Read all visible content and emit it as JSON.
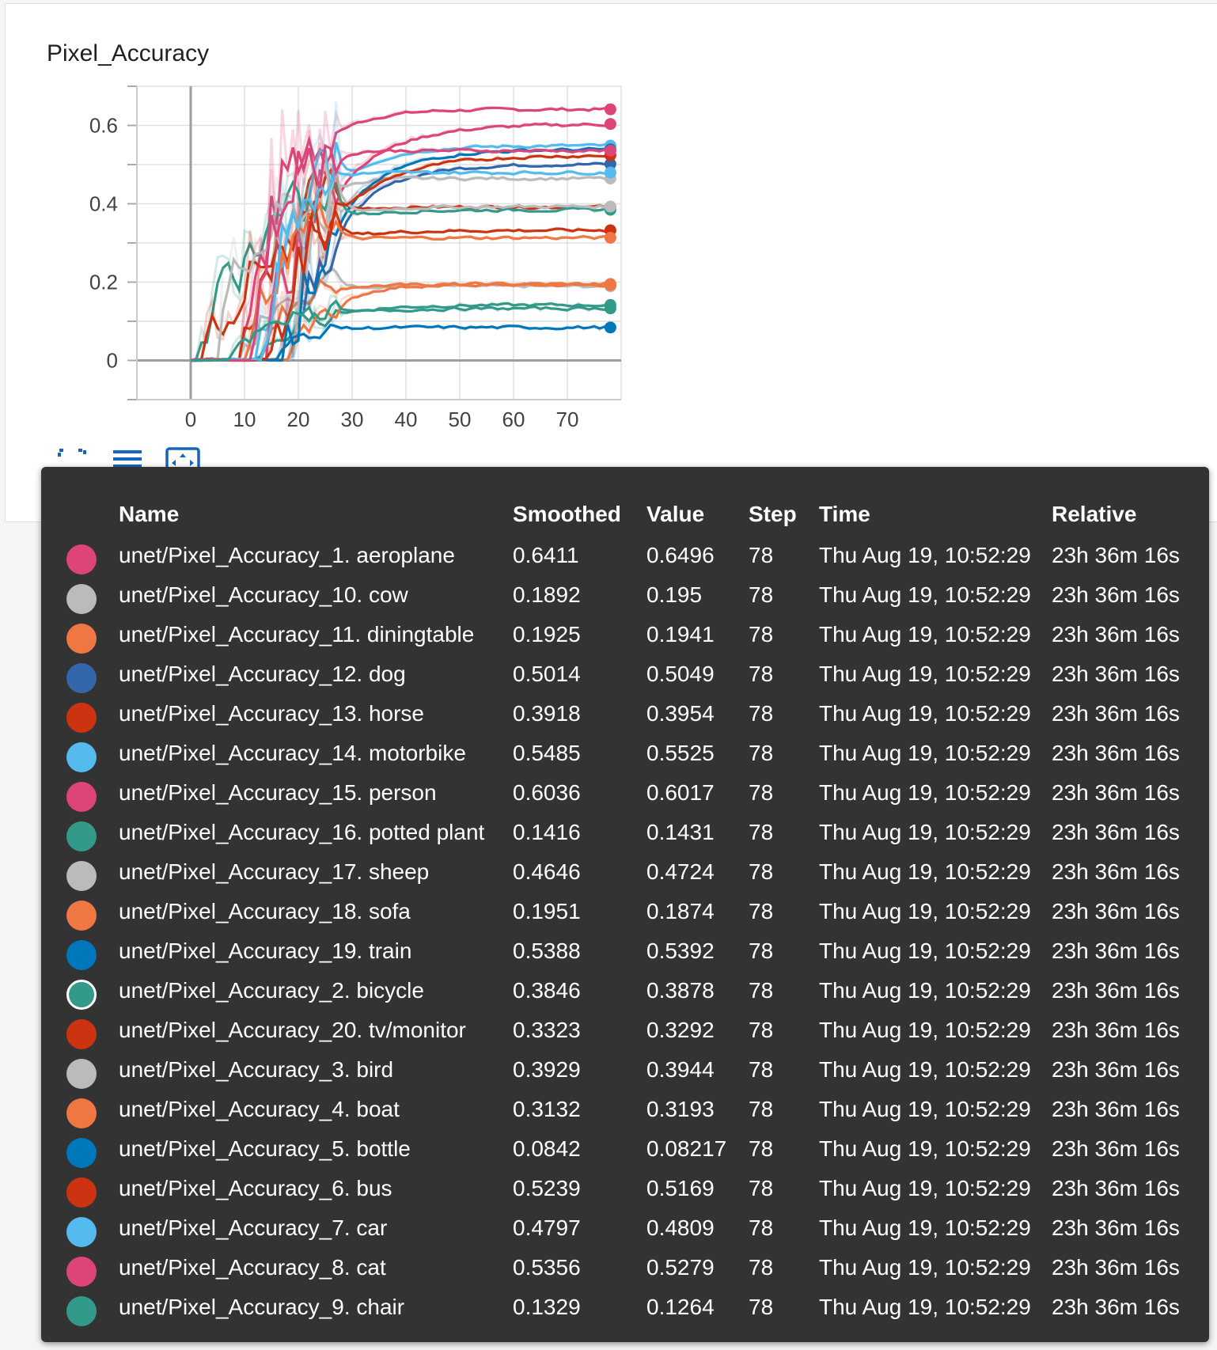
{
  "chart_data": {
    "type": "line",
    "title": "Pixel_Accuracy",
    "xlabel": "",
    "ylabel": "",
    "x_ticks": [
      0,
      10,
      20,
      30,
      40,
      50,
      60,
      70
    ],
    "y_ticks": [
      0,
      0.2,
      0.4,
      0.6
    ],
    "xlim": [
      -10,
      80
    ],
    "ylim": [
      -0.1,
      0.7
    ],
    "grid": true,
    "final_step": 78,
    "series": [
      {
        "name": "unet/Pixel_Accuracy_1. aeroplane",
        "color": "#dd4477",
        "smoothed": 0.6411,
        "value": 0.6496
      },
      {
        "name": "unet/Pixel_Accuracy_10. cow",
        "color": "#bbbbbb",
        "smoothed": 0.1892,
        "value": 0.195
      },
      {
        "name": "unet/Pixel_Accuracy_11. diningtable",
        "color": "#ee7744",
        "smoothed": 0.1925,
        "value": 0.1941
      },
      {
        "name": "unet/Pixel_Accuracy_12. dog",
        "color": "#3366aa",
        "smoothed": 0.5014,
        "value": 0.5049
      },
      {
        "name": "unet/Pixel_Accuracy_13. horse",
        "color": "#cc3311",
        "smoothed": 0.3918,
        "value": 0.3954
      },
      {
        "name": "unet/Pixel_Accuracy_14. motorbike",
        "color": "#55bbee",
        "smoothed": 0.5485,
        "value": 0.5525
      },
      {
        "name": "unet/Pixel_Accuracy_15. person",
        "color": "#dd4477",
        "smoothed": 0.6036,
        "value": 0.6017
      },
      {
        "name": "unet/Pixel_Accuracy_16. potted plant",
        "color": "#339988",
        "smoothed": 0.1416,
        "value": 0.1431
      },
      {
        "name": "unet/Pixel_Accuracy_17. sheep",
        "color": "#bbbbbb",
        "smoothed": 0.4646,
        "value": 0.4724
      },
      {
        "name": "unet/Pixel_Accuracy_18. sofa",
        "color": "#ee7744",
        "smoothed": 0.1951,
        "value": 0.1874
      },
      {
        "name": "unet/Pixel_Accuracy_19. train",
        "color": "#0077bb",
        "smoothed": 0.5388,
        "value": 0.5392
      },
      {
        "name": "unet/Pixel_Accuracy_2. bicycle",
        "color": "#339988",
        "smoothed": 0.3846,
        "value": 0.3878,
        "selected": true
      },
      {
        "name": "unet/Pixel_Accuracy_20. tv/monitor",
        "color": "#cc3311",
        "smoothed": 0.3323,
        "value": 0.3292
      },
      {
        "name": "unet/Pixel_Accuracy_3. bird",
        "color": "#bbbbbb",
        "smoothed": 0.3929,
        "value": 0.3944
      },
      {
        "name": "unet/Pixel_Accuracy_4. boat",
        "color": "#ee7744",
        "smoothed": 0.3132,
        "value": 0.3193
      },
      {
        "name": "unet/Pixel_Accuracy_5. bottle",
        "color": "#0077bb",
        "smoothed": 0.0842,
        "value": 0.08217
      },
      {
        "name": "unet/Pixel_Accuracy_6. bus",
        "color": "#cc3311",
        "smoothed": 0.5239,
        "value": 0.5169
      },
      {
        "name": "unet/Pixel_Accuracy_7. car",
        "color": "#55bbee",
        "smoothed": 0.4797,
        "value": 0.4809
      },
      {
        "name": "unet/Pixel_Accuracy_8. cat",
        "color": "#dd4477",
        "smoothed": 0.5356,
        "value": 0.5279
      },
      {
        "name": "unet/Pixel_Accuracy_9. chair",
        "color": "#339988",
        "smoothed": 0.1329,
        "value": 0.1264
      }
    ]
  },
  "controls": {
    "expand_icon": "expand-icon",
    "legend_icon": "list-icon",
    "fit_icon": "fit-domain-icon"
  },
  "tooltip": {
    "headers": {
      "name": "Name",
      "smoothed": "Smoothed",
      "value": "Value",
      "step": "Step",
      "time": "Time",
      "relative": "Relative"
    },
    "rows": [
      {
        "name": "unet/Pixel_Accuracy_1. aeroplane",
        "smoothed": "0.6411",
        "value": "0.6496",
        "step": "78",
        "time": "Thu Aug 19, 10:52:29",
        "relative": "23h 36m 16s"
      },
      {
        "name": "unet/Pixel_Accuracy_10. cow",
        "smoothed": "0.1892",
        "value": "0.195",
        "step": "78",
        "time": "Thu Aug 19, 10:52:29",
        "relative": "23h 36m 16s"
      },
      {
        "name": "unet/Pixel_Accuracy_11. diningtable",
        "smoothed": "0.1925",
        "value": "0.1941",
        "step": "78",
        "time": "Thu Aug 19, 10:52:29",
        "relative": "23h 36m 16s"
      },
      {
        "name": "unet/Pixel_Accuracy_12. dog",
        "smoothed": "0.5014",
        "value": "0.5049",
        "step": "78",
        "time": "Thu Aug 19, 10:52:29",
        "relative": "23h 36m 16s"
      },
      {
        "name": "unet/Pixel_Accuracy_13. horse",
        "smoothed": "0.3918",
        "value": "0.3954",
        "step": "78",
        "time": "Thu Aug 19, 10:52:29",
        "relative": "23h 36m 16s"
      },
      {
        "name": "unet/Pixel_Accuracy_14. motorbike",
        "smoothed": "0.5485",
        "value": "0.5525",
        "step": "78",
        "time": "Thu Aug 19, 10:52:29",
        "relative": "23h 36m 16s"
      },
      {
        "name": "unet/Pixel_Accuracy_15. person",
        "smoothed": "0.6036",
        "value": "0.6017",
        "step": "78",
        "time": "Thu Aug 19, 10:52:29",
        "relative": "23h 36m 16s"
      },
      {
        "name": "unet/Pixel_Accuracy_16. potted plant",
        "smoothed": "0.1416",
        "value": "0.1431",
        "step": "78",
        "time": "Thu Aug 19, 10:52:29",
        "relative": "23h 36m 16s"
      },
      {
        "name": "unet/Pixel_Accuracy_17. sheep",
        "smoothed": "0.4646",
        "value": "0.4724",
        "step": "78",
        "time": "Thu Aug 19, 10:52:29",
        "relative": "23h 36m 16s"
      },
      {
        "name": "unet/Pixel_Accuracy_18. sofa",
        "smoothed": "0.1951",
        "value": "0.1874",
        "step": "78",
        "time": "Thu Aug 19, 10:52:29",
        "relative": "23h 36m 16s"
      },
      {
        "name": "unet/Pixel_Accuracy_19. train",
        "smoothed": "0.5388",
        "value": "0.5392",
        "step": "78",
        "time": "Thu Aug 19, 10:52:29",
        "relative": "23h 36m 16s"
      },
      {
        "name": "unet/Pixel_Accuracy_2. bicycle",
        "smoothed": "0.3846",
        "value": "0.3878",
        "step": "78",
        "time": "Thu Aug 19, 10:52:29",
        "relative": "23h 36m 16s"
      },
      {
        "name": "unet/Pixel_Accuracy_20. tv/monitor",
        "smoothed": "0.3323",
        "value": "0.3292",
        "step": "78",
        "time": "Thu Aug 19, 10:52:29",
        "relative": "23h 36m 16s"
      },
      {
        "name": "unet/Pixel_Accuracy_3. bird",
        "smoothed": "0.3929",
        "value": "0.3944",
        "step": "78",
        "time": "Thu Aug 19, 10:52:29",
        "relative": "23h 36m 16s"
      },
      {
        "name": "unet/Pixel_Accuracy_4. boat",
        "smoothed": "0.3132",
        "value": "0.3193",
        "step": "78",
        "time": "Thu Aug 19, 10:52:29",
        "relative": "23h 36m 16s"
      },
      {
        "name": "unet/Pixel_Accuracy_5. bottle",
        "smoothed": "0.0842",
        "value": "0.08217",
        "step": "78",
        "time": "Thu Aug 19, 10:52:29",
        "relative": "23h 36m 16s"
      },
      {
        "name": "unet/Pixel_Accuracy_6. bus",
        "smoothed": "0.5239",
        "value": "0.5169",
        "step": "78",
        "time": "Thu Aug 19, 10:52:29",
        "relative": "23h 36m 16s"
      },
      {
        "name": "unet/Pixel_Accuracy_7. car",
        "smoothed": "0.4797",
        "value": "0.4809",
        "step": "78",
        "time": "Thu Aug 19, 10:52:29",
        "relative": "23h 36m 16s"
      },
      {
        "name": "unet/Pixel_Accuracy_8. cat",
        "smoothed": "0.5356",
        "value": "0.5279",
        "step": "78",
        "time": "Thu Aug 19, 10:52:29",
        "relative": "23h 36m 16s"
      },
      {
        "name": "unet/Pixel_Accuracy_9. chair",
        "smoothed": "0.1329",
        "value": "0.1264",
        "step": "78",
        "time": "Thu Aug 19, 10:52:29",
        "relative": "23h 36m 16s"
      }
    ]
  }
}
